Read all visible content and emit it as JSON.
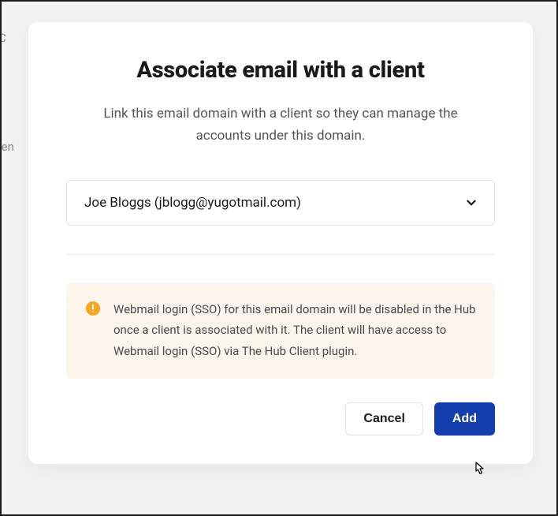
{
  "colors": {
    "primary": "#133ead",
    "notice_bg": "#fcf5ec",
    "notice_icon": "#f5a623"
  },
  "background": {
    "fragment_1": "C",
    "fragment_2": "ien"
  },
  "modal": {
    "title": "Associate email with a client",
    "subtitle": "Link this email domain with a client so they can manage the accounts under this domain.",
    "client_select": {
      "value": "Joe Bloggs (jblogg@yugotmail.com)"
    },
    "notice": "Webmail login (SSO) for this email domain will be disabled in the Hub once a client is associated with it. The client will have access to Webmail login (SSO) via The Hub Client plugin.",
    "buttons": {
      "cancel": "Cancel",
      "add": "Add"
    }
  }
}
